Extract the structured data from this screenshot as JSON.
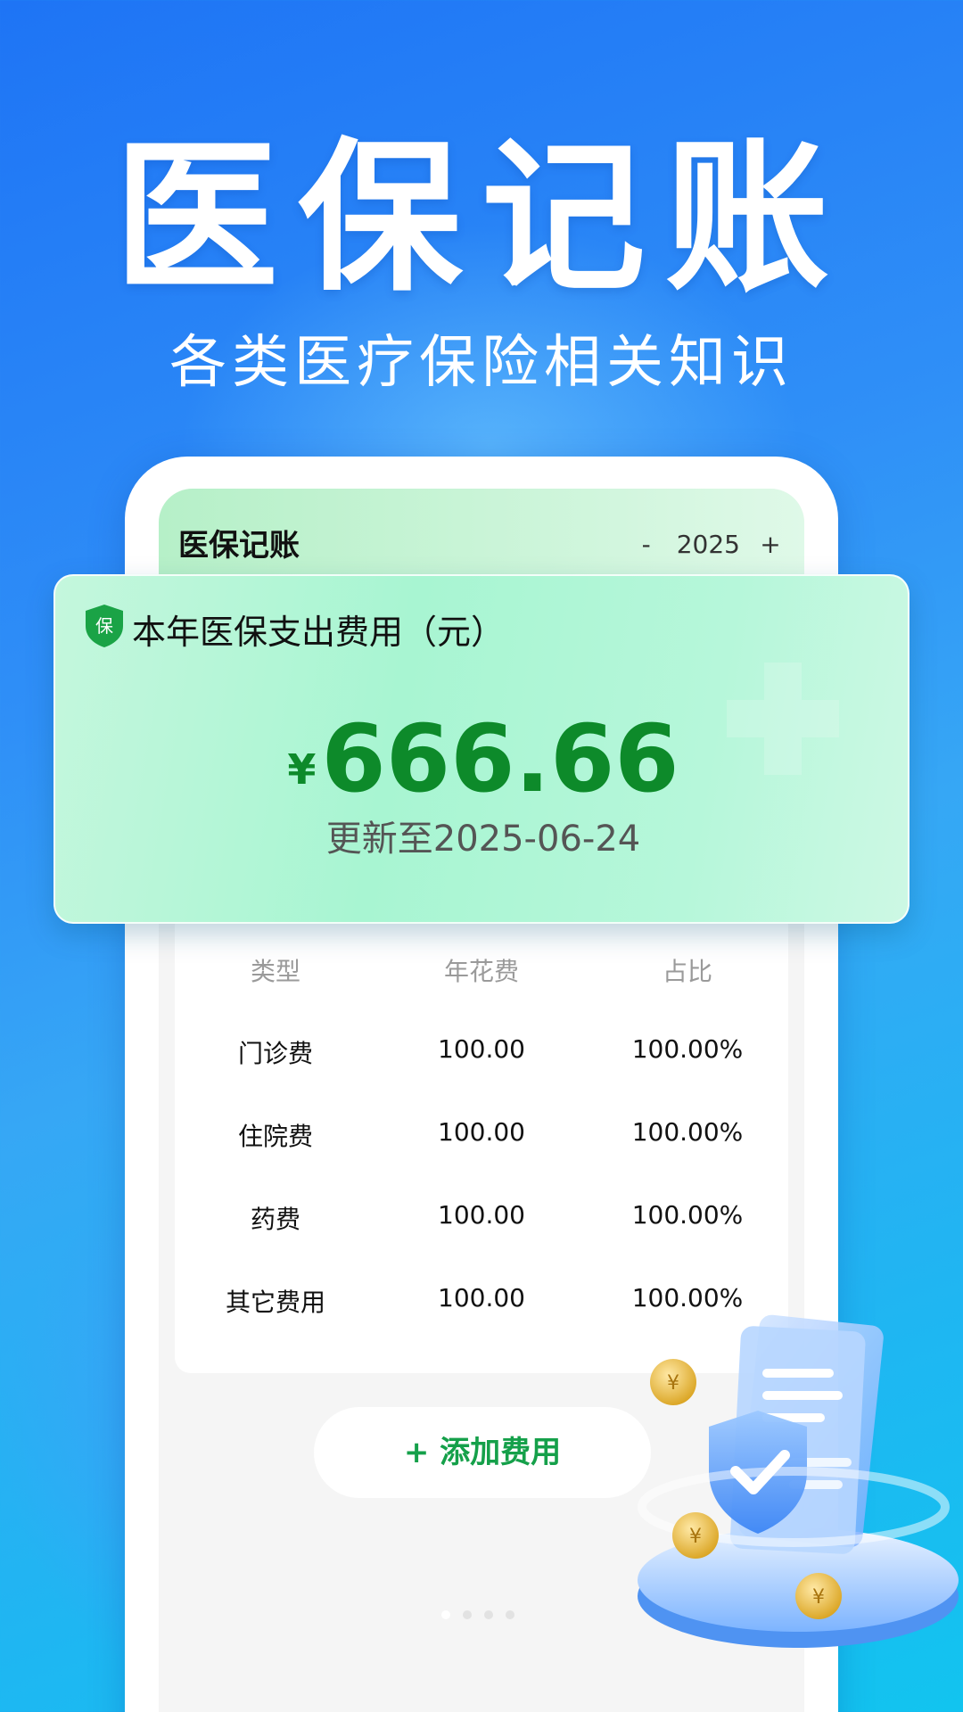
{
  "promo": {
    "headline": "医保记账",
    "subline": "各类医疗保险相关知识"
  },
  "app": {
    "title": "医保记账",
    "year_minus": "-",
    "year": "2025",
    "year_plus": "+"
  },
  "summary": {
    "badge_text": "保",
    "label": "本年医保支出费用（元）",
    "currency": "¥",
    "amount": "666.66",
    "updated": "更新至2025-06-24"
  },
  "table": {
    "headers": [
      "类型",
      "年花费",
      "占比"
    ],
    "rows": [
      [
        "门诊费",
        "100.00",
        "100.00%"
      ],
      [
        "住院费",
        "100.00",
        "100.00%"
      ],
      [
        "药费",
        "100.00",
        "100.00%"
      ],
      [
        "其它费用",
        "100.00",
        "100.00%"
      ]
    ]
  },
  "actions": {
    "add_label": "+ 添加费用"
  },
  "pager": {
    "count": 4,
    "active_index": 0
  },
  "colors": {
    "accent_green": "#15a04a",
    "amount_green": "#0d8a2a",
    "bg_blue": "#1e74f5"
  },
  "icons": {
    "badge": "shield-badge-icon",
    "illustration": "shield-document-coins-illustration"
  }
}
